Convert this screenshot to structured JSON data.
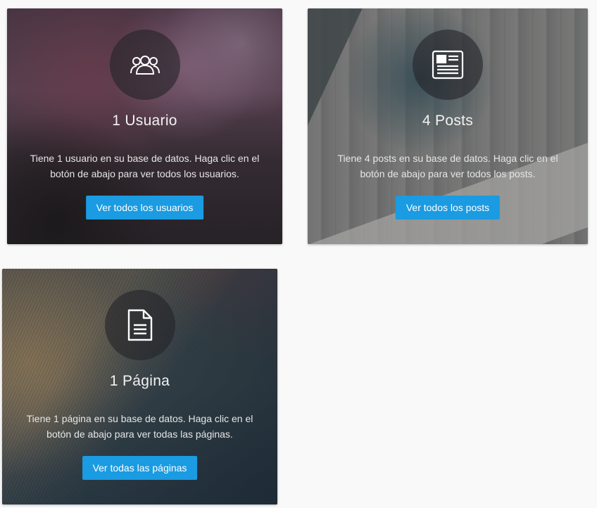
{
  "cards": [
    {
      "title": "1 Usuario",
      "text": "Tiene 1 usuario en su base de datos. Haga clic en el botón de abajo para ver todos los usuarios.",
      "button": "Ver todos los usuarios",
      "icon": "users-icon"
    },
    {
      "title": "4 Posts",
      "text": "Tiene 4 posts en su base de datos. Haga clic en el botón de abajo para ver todos los posts.",
      "button": "Ver todos los posts",
      "icon": "newspaper-icon"
    },
    {
      "title": "1 Página",
      "text": "Tiene 1 página en su base de datos. Haga clic en el botón de abajo para ver todas las páginas.",
      "button": "Ver todas las páginas",
      "icon": "document-icon"
    }
  ],
  "colors": {
    "button": "#1a9be2",
    "page_background": "#f9f9f9"
  }
}
